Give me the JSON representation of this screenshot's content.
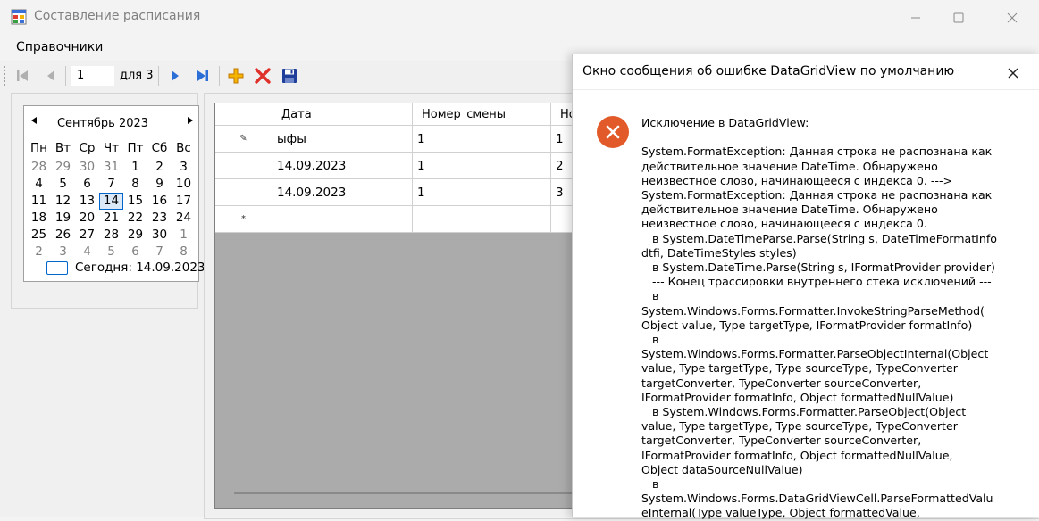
{
  "window": {
    "title": "Составление расписания"
  },
  "menu": {
    "items": [
      "Справочники"
    ]
  },
  "navigator": {
    "position": "1",
    "count_label": "для 3"
  },
  "calendar": {
    "month_year": "Сентябрь 2023",
    "weekdays": [
      "Пн",
      "Вт",
      "Ср",
      "Чт",
      "Пт",
      "Сб",
      "Вс"
    ],
    "weeks": [
      [
        "28",
        "29",
        "30",
        "31",
        "1",
        "2",
        "3"
      ],
      [
        "4",
        "5",
        "6",
        "7",
        "8",
        "9",
        "10"
      ],
      [
        "11",
        "12",
        "13",
        "14",
        "15",
        "16",
        "17"
      ],
      [
        "18",
        "19",
        "20",
        "21",
        "22",
        "23",
        "24"
      ],
      [
        "25",
        "26",
        "27",
        "28",
        "29",
        "30",
        "1"
      ],
      [
        "2",
        "3",
        "4",
        "5",
        "6",
        "7",
        "8"
      ]
    ],
    "selected_day": "14",
    "today_label": "Сегодня: 14.09.2023"
  },
  "grid": {
    "columns": [
      "Дата",
      "Номер_смены",
      "Но"
    ],
    "rows": [
      {
        "marker": "✎",
        "cells": [
          "ыфы",
          "1",
          "1"
        ]
      },
      {
        "marker": "",
        "cells": [
          "14.09.2023",
          "1",
          "2"
        ]
      },
      {
        "marker": "",
        "cells": [
          "14.09.2023",
          "1",
          "3"
        ]
      }
    ],
    "new_row_marker": "*"
  },
  "error_dialog": {
    "title": "Окно сообщения об ошибке DataGridView по умолчанию",
    "message": "Исключение в DataGridView:\n\nSystem.FormatException: Данная строка не распознана как\nдействительное значение DateTime. Обнаружено\nнеизвестное слово, начинающееся с индекса 0. --->\nSystem.FormatException: Данная строка не распознана как\nдействительное значение DateTime. Обнаружено\nнеизвестное слово, начинающееся с индекса 0.\n   в System.DateTimeParse.Parse(String s, DateTimeFormatInfo\ndtfi, DateTimeStyles styles)\n   в System.DateTime.Parse(String s, IFormatProvider provider)\n   --- Конец трассировки внутреннего стека исключений ---\n   в\nSystem.Windows.Forms.Formatter.InvokeStringParseMethod(\nObject value, Type targetType, IFormatProvider formatInfo)\n   в\nSystem.Windows.Forms.Formatter.ParseObjectInternal(Object\nvalue, Type targetType, Type sourceType, TypeConverter\ntargetConverter, TypeConverter sourceConverter,\nIFormatProvider formatInfo, Object formattedNullValue)\n   в System.Windows.Forms.Formatter.ParseObject(Object\nvalue, Type targetType, Type sourceType, TypeConverter\ntargetConverter, TypeConverter sourceConverter,\nIFormatProvider formatInfo, Object formattedNullValue,\nObject dataSourceNullValue)\n   в\nSystem.Windows.Forms.DataGridViewCell.ParseFormattedValu\neInternal(Type valueType, Object formattedValue,"
  },
  "colors": {
    "nav_blue": "#2b6fd6",
    "add_orange": "#f0a800",
    "delete_red": "#e0302a",
    "save_navy": "#1f3f9a",
    "error_red": "#e25a2a",
    "grid_empty": "#ababab"
  },
  "icons": {
    "app": "app-icon",
    "minimize": "minimize-icon",
    "maximize": "maximize-icon",
    "close": "close-icon",
    "move_first": "move-first-icon",
    "move_previous": "move-previous-icon",
    "move_next": "move-next-icon",
    "move_last": "move-last-icon",
    "add": "add-icon",
    "delete": "delete-icon",
    "save": "save-icon",
    "error": "error-icon"
  }
}
